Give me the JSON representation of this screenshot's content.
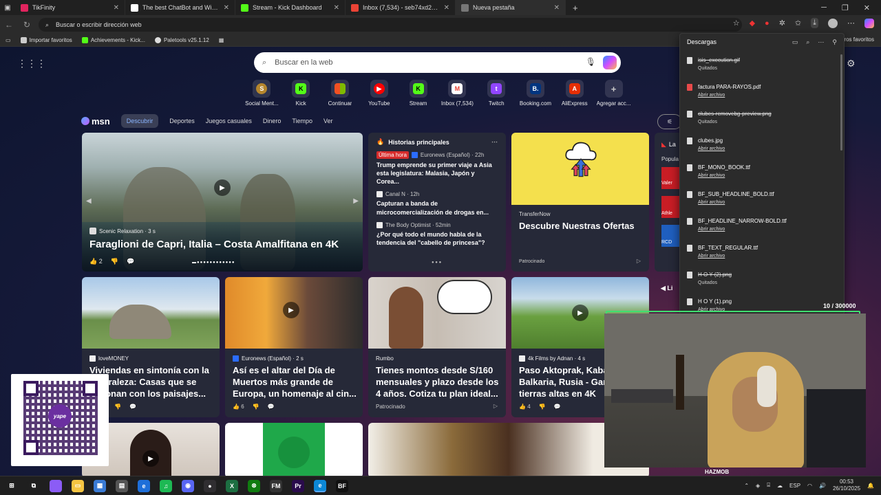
{
  "tabs": [
    {
      "label": "TikFinity",
      "color": "#e0245e"
    },
    {
      "label": "The best ChatBot and Widgets fo",
      "color": "#ffffff"
    },
    {
      "label": "Stream - Kick Dashboard",
      "color": "#53fc18"
    },
    {
      "label": "Inbox (7,534) - seb74xd27@gmai",
      "color": "#ea4335"
    },
    {
      "label": "Nueva pestaña",
      "color": "#cccccc"
    }
  ],
  "address": {
    "placeholder": "Buscar o escribir dirección web"
  },
  "bookmarks": [
    {
      "label": "Importar favoritos",
      "color": "#cccccc"
    },
    {
      "label": "Achievements - Kick...",
      "color": "#53fc18"
    },
    {
      "label": "Paletools v25.1.12",
      "color": "#dddddd"
    }
  ],
  "bookmarks_right": "ros favoritos",
  "search": {
    "placeholder": "Buscar en la web"
  },
  "tiles": [
    {
      "label": "Social Ment...",
      "letter": "S",
      "bg": "#b5862d"
    },
    {
      "label": "Kick",
      "letter": "K",
      "bg": "#53fc18"
    },
    {
      "label": "Continuar",
      "letter": "",
      "bg": "#f25022"
    },
    {
      "label": "YouTube",
      "letter": "▶",
      "bg": "#ff0000"
    },
    {
      "label": "Stream",
      "letter": "K",
      "bg": "#53fc18"
    },
    {
      "label": "Inbox (7,534)",
      "letter": "M",
      "bg": "#ea4335"
    },
    {
      "label": "Twitch",
      "letter": "t",
      "bg": "#9146ff"
    },
    {
      "label": "Booking.com",
      "letter": "B.",
      "bg": "#003580"
    },
    {
      "label": "AliExpress",
      "letter": "A",
      "bg": "#e62e04"
    },
    {
      "label": "Agregar acc...",
      "letter": "+",
      "bg": "#555555"
    }
  ],
  "msn": {
    "logo": "msn",
    "nav": [
      "Descubrir",
      "Deportes",
      "Juegos casuales",
      "Dinero",
      "Tiempo",
      "Ver"
    ]
  },
  "hero": {
    "source": "Scenic Relaxation · 3 s",
    "title": "Faraglioni de Capri, Italia – Costa Amalfitana en 4K",
    "likes": "2"
  },
  "top_stories": {
    "heading": "Historias principales",
    "items": [
      {
        "badge": "Última hora",
        "meta": "Euronews (Español) · 22h",
        "title": "Trump emprende su primer viaje a Asia esta legislatura: Malasia, Japón y Corea..."
      },
      {
        "badge": "",
        "meta": "Canal N · 12h",
        "title": "Capturan a banda de microcomercialización de drogas en..."
      },
      {
        "badge": "",
        "meta": "The Body Optimist · 52min",
        "title": "¿Por qué todo el mundo habla de la tendencia del \"cabello de princesa\"?"
      }
    ]
  },
  "ad1": {
    "brand": "TransferNow",
    "title": "Descubre Nuestras Ofertas",
    "sponsored": "Patrocinado"
  },
  "side_texts": {
    "la": "La",
    "popular": "Popula",
    "valer": "Valer",
    "athle": "Athle",
    "rcd": "RCD",
    "li": "Li"
  },
  "row2": [
    {
      "source": "loveMONEY",
      "title": "Viviendas en sintonía con la naturaleza: Casas que se fusionan con los paisajes...",
      "footer": "",
      "color": "#6fa3d8"
    },
    {
      "source": "Euronews (Español) · 2 s",
      "title": "Así es el altar del Día de Muertos más grande de Europa, un homenaje al cin...",
      "footer": "6",
      "color": "#d67a2a"
    },
    {
      "source": "Rumbo",
      "title": "Tienes montos desde S/160 mensuales y plazo desde los 4 años. Cotiza tu plan ideal...",
      "footer": "Patrocinado",
      "color": "#c9c4c0"
    },
    {
      "source": "4k Films by Adnan · 4 s",
      "title": "Paso Aktoprak, Kabardino-Balkaria, Rusia - Gana las tierras altas en 4K",
      "footer": "4",
      "color": "#5d8a3a"
    }
  ],
  "qr": {
    "brand": "yape"
  },
  "downloads": {
    "title": "Descargas",
    "items": [
      {
        "name": "isis_execution.gif",
        "status": "Quitados",
        "deleted": true,
        "type": "img"
      },
      {
        "name": "factura PARA-RAYOS.pdf",
        "status": "Abrir archivo",
        "deleted": false,
        "type": "pdf"
      },
      {
        "name": "clubes-removebg-preview.png",
        "status": "Quitados",
        "deleted": true,
        "type": "img"
      },
      {
        "name": "clubes.jpg",
        "status": "Abrir archivo",
        "deleted": false,
        "type": "img"
      },
      {
        "name": "BF_MONO_BOOK.ttf",
        "status": "Abrir archivo",
        "deleted": false,
        "type": "font"
      },
      {
        "name": "BF_SUB_HEADLINE_BOLD.ttf",
        "status": "Abrir archivo",
        "deleted": false,
        "type": "font"
      },
      {
        "name": "BF_HEADLINE_NARROW-BOLD.ttf",
        "status": "Abrir archivo",
        "deleted": false,
        "type": "font"
      },
      {
        "name": "BF_TEXT_REGULAR.ttf",
        "status": "Abrir archivo",
        "deleted": false,
        "type": "font"
      },
      {
        "name": "H O Y (2).png",
        "status": "Quitados",
        "deleted": true,
        "type": "img"
      },
      {
        "name": "H O Y (1).png",
        "status": "Abrir archivo",
        "deleted": false,
        "type": "img"
      }
    ]
  },
  "overlay": {
    "counter": "10  / 300000",
    "hazmob": "HAZMOB"
  },
  "taskbar": {
    "apps": [
      {
        "name": "start",
        "letter": "⊞",
        "color": "#1f1f1f"
      },
      {
        "name": "task-view",
        "letter": "⧉",
        "color": "#1f1f1f"
      },
      {
        "name": "copilot",
        "letter": "",
        "color": "#8b5cf6"
      },
      {
        "name": "explorer",
        "letter": "▭",
        "color": "#f5c542"
      },
      {
        "name": "store",
        "letter": "▦",
        "color": "#3a7bd5"
      },
      {
        "name": "files",
        "letter": "▤",
        "color": "#555555"
      },
      {
        "name": "edge-dev",
        "letter": "e",
        "color": "#1e6fd9"
      },
      {
        "name": "spotify",
        "letter": "♫",
        "color": "#1db954"
      },
      {
        "name": "discord",
        "letter": "◉",
        "color": "#5865f2"
      },
      {
        "name": "obs",
        "letter": "●",
        "color": "#302e31"
      },
      {
        "name": "excel",
        "letter": "X",
        "color": "#1d6f42"
      },
      {
        "name": "xbox",
        "letter": "⊗",
        "color": "#107c10"
      },
      {
        "name": "fm",
        "letter": "FM",
        "color": "#333333"
      },
      {
        "name": "premiere",
        "letter": "Pr",
        "color": "#2a0b4c"
      },
      {
        "name": "edge",
        "letter": "e",
        "color": "#0c88d6"
      },
      {
        "name": "bf",
        "letter": "BF",
        "color": "#111111"
      }
    ],
    "lang": "ESP",
    "time": "00:53",
    "date": "26/10/2025"
  }
}
